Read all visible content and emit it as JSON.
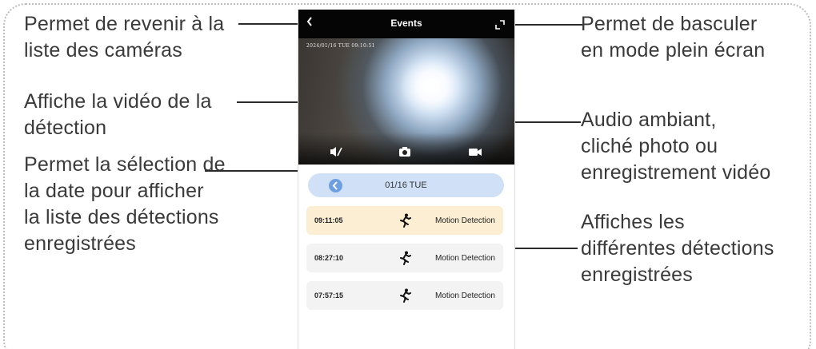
{
  "annotations": {
    "back": [
      "Permet de revenir à la",
      "liste des caméras"
    ],
    "video": [
      "Affiche la vidéo de la",
      "détection"
    ],
    "date": [
      "Permet la sélection de",
      "la date pour afficher",
      "la liste des détections",
      "enregistrées"
    ],
    "fullscreen": [
      "Permet de basculer",
      "en mode plein écran"
    ],
    "controls": [
      "Audio ambiant,",
      "cliché photo ou",
      "enregistrement vidéo"
    ],
    "events": [
      "Affiches les",
      "différentes détections",
      "enregistrées"
    ]
  },
  "app": {
    "title": "Events",
    "back_icon": "chevron-left-icon",
    "fullscreen_icon": "fullscreen-icon"
  },
  "video": {
    "timestamp": "2024/01/16 TUE 09:10:51",
    "controls": [
      "mute-audio-icon",
      "snapshot-icon",
      "record-video-icon"
    ]
  },
  "date_selector": {
    "value": "01/16 TUE"
  },
  "events": [
    {
      "time": "09:11:05",
      "label": "Motion Detection",
      "icon": "running-person-icon",
      "highlighted": true
    },
    {
      "time": "08:27:10",
      "label": "Motion Detection",
      "icon": "running-person-icon",
      "highlighted": false
    },
    {
      "time": "07:57:15",
      "label": "Motion Detection",
      "icon": "running-person-icon",
      "highlighted": false
    }
  ],
  "colors": {
    "highlight": "#fbeed3",
    "event_bg": "#f3f3f3",
    "date_bar": "#cfe0f7",
    "accent": "#6e9fe0"
  }
}
